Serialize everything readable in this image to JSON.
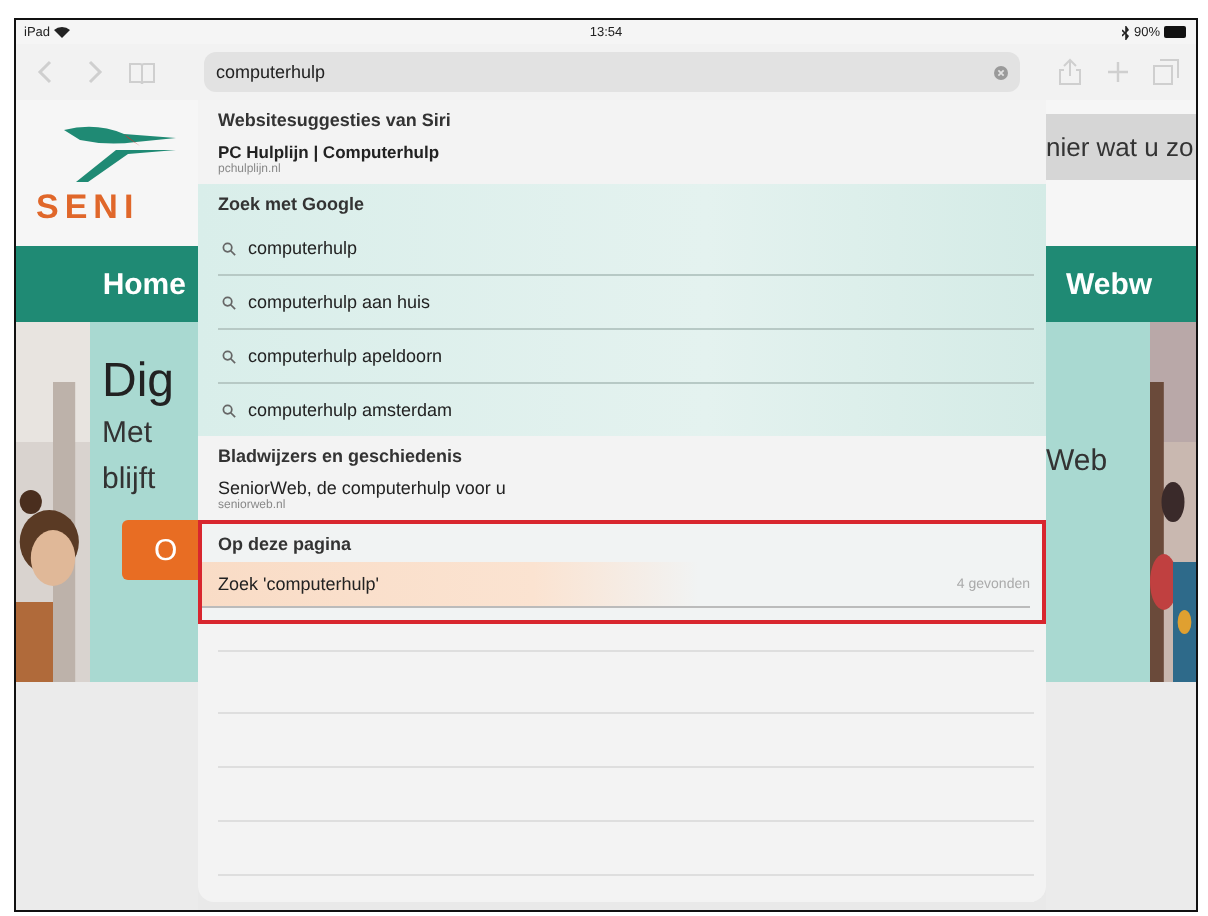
{
  "status_bar": {
    "device": "iPad",
    "time": "13:54",
    "battery": "90%"
  },
  "toolbar": {
    "address": {
      "value": "computerhulp"
    }
  },
  "background_page": {
    "left": {
      "logo_text": "SENI",
      "nav_item": "Home",
      "heading": "Dig",
      "lines": [
        "Met",
        "blijft"
      ],
      "button": "O"
    },
    "right": {
      "search_text": "nier wat u zo",
      "nav_item": "Webw",
      "line": "Web"
    }
  },
  "suggestions": [
    {
      "title": "Websitesuggesties van Siri",
      "highlighted": false,
      "items": [
        {
          "kind": "site",
          "title": "PC Hulplijn | Computerhulp",
          "url": "pchulplijn.nl"
        }
      ]
    },
    {
      "title": "Zoek met Google",
      "highlighted": false,
      "items": [
        {
          "kind": "search",
          "text": "computerhulp"
        },
        {
          "kind": "search",
          "text": "computerhulp aan huis"
        },
        {
          "kind": "search",
          "text": "computerhulp apeldoorn"
        },
        {
          "kind": "search",
          "text": "computerhulp amsterdam"
        }
      ]
    },
    {
      "title": "Bladwijzers en geschiedenis",
      "highlighted": false,
      "items": [
        {
          "kind": "history",
          "title": "SeniorWeb, de computerhulp voor u",
          "url": "seniorweb.nl"
        }
      ]
    },
    {
      "title": "Op deze pagina",
      "highlighted": true,
      "items": [
        {
          "kind": "find",
          "text": "Zoek 'computerhulp'",
          "count": "4 gevonden"
        }
      ]
    }
  ]
}
